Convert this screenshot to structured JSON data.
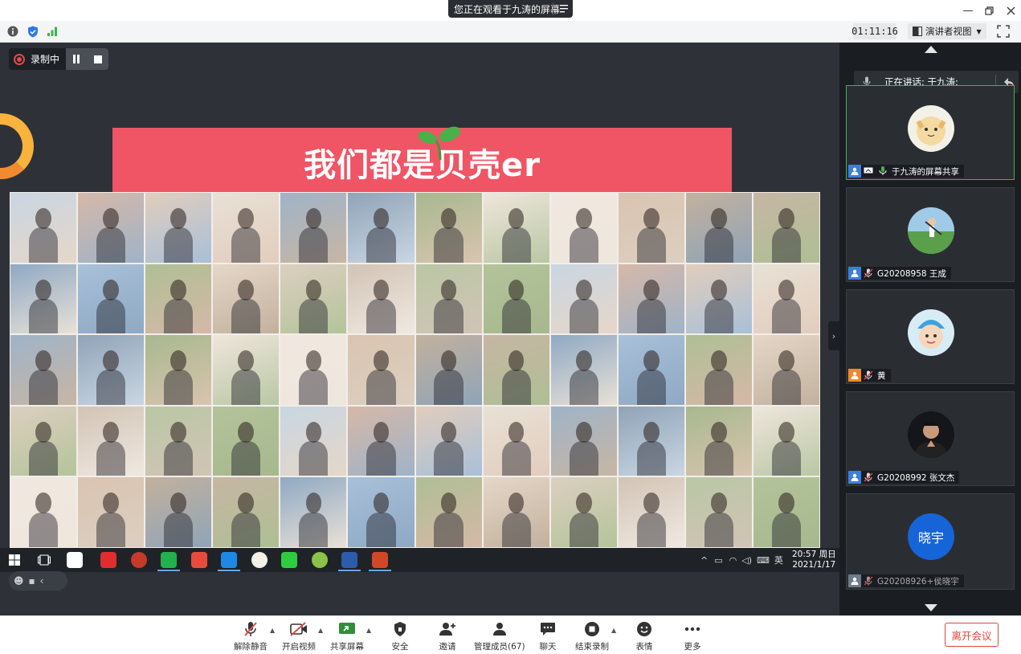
{
  "title_bar": {
    "share_notice": "您正在观看于九涛的屏幕",
    "controls": [
      "minimize",
      "restore",
      "close"
    ]
  },
  "info_bar": {
    "icons": [
      "info-icon",
      "shield-icon",
      "signal-icon"
    ],
    "timer": "01:11:16",
    "view_mode": "演讲者视图"
  },
  "recording": {
    "label": "录制中"
  },
  "slide": {
    "title": "我们都是贝壳er"
  },
  "shared_taskbar": {
    "clock_time": "20:57 周日",
    "clock_date": "2021/1/17",
    "ime_label": "英"
  },
  "panel": {
    "speaking_label": "正在讲话: 于九涛;",
    "participants": [
      {
        "name": "于九涛的屏幕共享",
        "badge": "blue",
        "type": "screen"
      },
      {
        "name": "G20208958 王成",
        "badge": "blue",
        "type": "golf"
      },
      {
        "name": "黄",
        "badge": "orange",
        "type": "kid"
      },
      {
        "name": "G20208992 张文杰",
        "badge": "blue",
        "type": "man"
      },
      {
        "name": "G20208926+侯晓宇",
        "badge": "grey",
        "type": "initials",
        "initials": "晓宇"
      }
    ]
  },
  "toolbar": {
    "unmute": "解除静音",
    "video": "开启视频",
    "share": "共享屏幕",
    "security": "安全",
    "invite": "邀请",
    "members": "管理成员(67)",
    "chat": "聊天",
    "stop_record": "结束录制",
    "reactions": "表情",
    "more": "更多",
    "leave": "离开会议"
  },
  "colors": {
    "banner": "#ef5565",
    "active_border": "#3fb34f",
    "leave": "#e0453a",
    "badge_blue": "#3a7ee0"
  }
}
